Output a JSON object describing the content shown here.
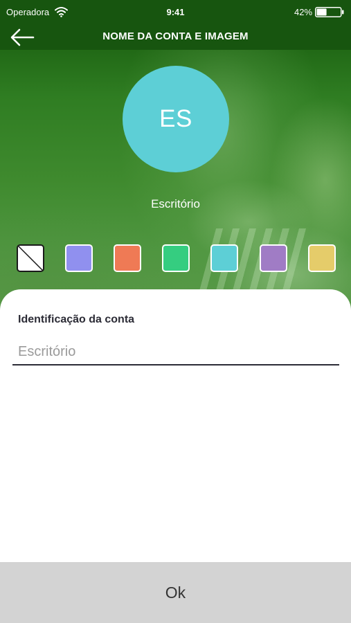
{
  "status_bar": {
    "carrier": "Operadora",
    "time": "9:41",
    "battery": "42%",
    "battery_level": 0.42
  },
  "nav": {
    "title": "NOME DA CONTA E IMAGEM",
    "back_icon": "arrow-left-icon"
  },
  "avatar": {
    "initials": "ES",
    "color": "#5dcfd6"
  },
  "account_name": "Escritório",
  "swatches": [
    {
      "name": "none",
      "color": "#ffffff"
    },
    {
      "name": "periwinkle",
      "color": "#9090ef"
    },
    {
      "name": "orange",
      "color": "#ef7a55"
    },
    {
      "name": "green",
      "color": "#35cd80"
    },
    {
      "name": "cyan",
      "color": "#5dcfd6"
    },
    {
      "name": "purple",
      "color": "#a07cc5"
    },
    {
      "name": "yellow",
      "color": "#e5cc6a"
    }
  ],
  "form": {
    "label": "Identificação da conta",
    "placeholder": "Escritório",
    "value": ""
  },
  "ok_button": {
    "label": "Ok"
  },
  "colors": {
    "header_green": "#17550f",
    "ok_bg": "#d3d3d3"
  }
}
